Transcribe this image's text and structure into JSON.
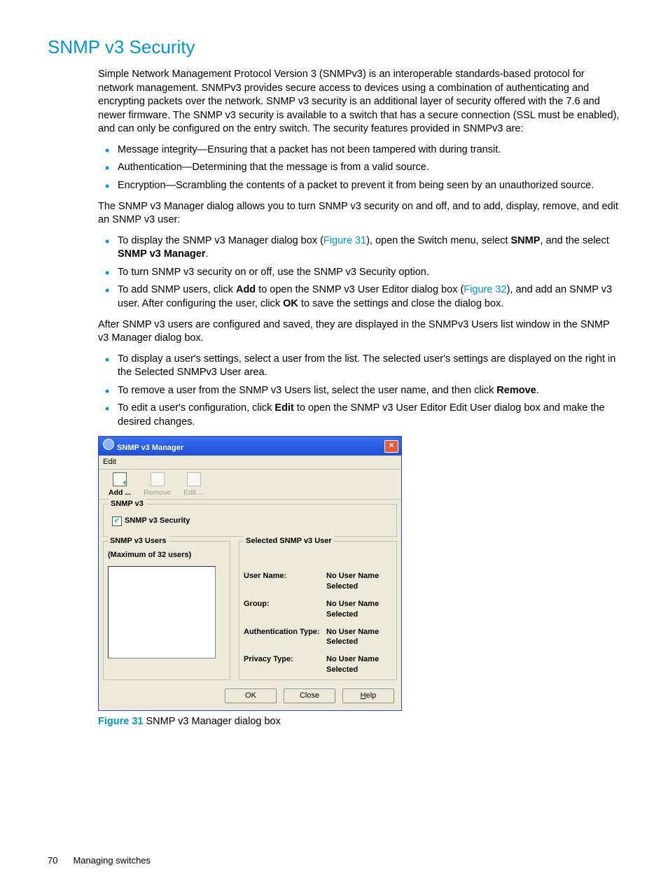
{
  "heading": "SNMP v3 Security",
  "intro": "Simple Network Management Protocol Version 3 (SNMPv3) is an interoperable standards-based protocol for network management. SNMPv3 provides secure access to devices using a combination of authenticating and encrypting packets over the network. SNMP v3 security is an additional layer of security offered with the 7.6 and newer firmware. The SNMP v3 security is available to a switch that has a secure connection (SSL must be enabled), and can only be configured on the entry switch. The security features provided in SNMPv3 are:",
  "features": [
    "Message integrity—Ensuring that a packet has not been tampered with during transit.",
    "Authentication—Determining that the message is from a valid source.",
    "Encryption—Scrambling the contents of a packet to prevent it from being seen by an unauthorized source."
  ],
  "manager_para": "The SNMP v3 Manager dialog allows you to turn SNMP v3 security on and off, and to add, display, remove, and edit an SNMP v3 user:",
  "howto": [
    {
      "pre": "To display the SNMP v3 Manager dialog box (",
      "link": "Figure 31",
      "mid": "), open the Switch menu, select ",
      "bold1": "SNMP",
      "mid2": ", and the select ",
      "bold2": "SNMP v3 Manager",
      "post": "."
    },
    {
      "text": "To turn SNMP v3 security on or off, use the SNMP v3 Security option."
    },
    {
      "pre": "To add SNMP users, click ",
      "bold1": "Add",
      "mid": " to open the SNMP v3 User Editor dialog box (",
      "link": "Figure 32",
      "mid2": "), and add an SNMP v3 user. After configuring the user, click ",
      "bold2": "OK",
      "post": " to save the settings and close the dialog box."
    }
  ],
  "after_para": "After SNMP v3 users are configured and saved, they are displayed in the SNMPv3 Users list window in the SNMP v3 Manager dialog box.",
  "userops": [
    "To display a user's settings, select a user from the list. The selected user's settings are displayed on the right in the Selected SNMPv3 User area.",
    {
      "pre": "To remove a user from the SNMP v3 Users list, select the user name, and then click ",
      "bold": "Remove",
      "post": "."
    },
    {
      "pre": "To edit a user's configuration, click ",
      "bold": "Edit",
      "post": " to open the SNMP v3 User Editor Edit User dialog box and make the desired changes."
    }
  ],
  "dialog": {
    "title": "SNMP v3 Manager",
    "menu_edit": "Edit",
    "tools": {
      "add": "Add ...",
      "remove": "Remove",
      "edit": "Edit ..."
    },
    "group_top": "SNMP v3",
    "checkbox": "SNMP v3 Security",
    "users_group": "SNMP v3 Users",
    "users_note": "(Maximum of 32 users)",
    "selected_group": "Selected SNMP v3 User",
    "fields": {
      "username_label": "User Name:",
      "username_val": "No User Name Selected",
      "group_label": "Group:",
      "group_val": "No User Name Selected",
      "auth_label": "Authentication Type:",
      "auth_val": "No User Name Selected",
      "priv_label": "Privacy Type:",
      "priv_val": "No User Name Selected"
    },
    "buttons": {
      "ok": "OK",
      "close": "Close",
      "help": "Help"
    }
  },
  "caption": {
    "fig": "Figure 31",
    "text": " SNMP v3 Manager dialog box"
  },
  "footer": {
    "page": "70",
    "section": "Managing switches"
  }
}
